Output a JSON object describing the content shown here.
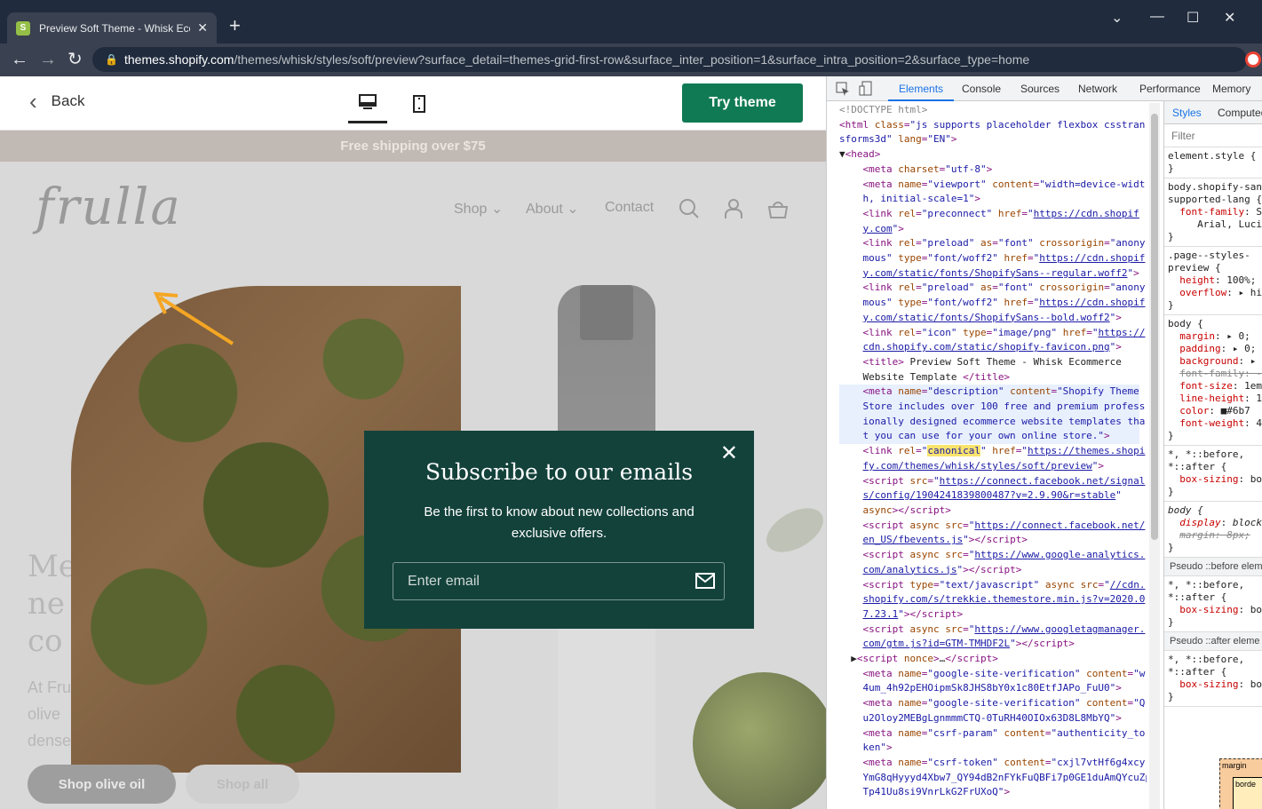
{
  "browser": {
    "tab_title": "Preview Soft Theme - Whisk Ecor",
    "url_host": "themes.shopify.com",
    "url_path": "/themes/whisk/styles/soft/preview?surface_detail=themes-grid-first-row&surface_inter_position=1&surface_intra_position=2&surface_type=home"
  },
  "preview_bar": {
    "back_label": "Back",
    "try_label": "Try theme"
  },
  "store": {
    "promo": "Free shipping over $75",
    "logo": "frulla",
    "nav": [
      "Shop",
      "About",
      "Contact"
    ],
    "hero_title_lines": [
      "Me",
      "ne",
      "co"
    ],
    "hero_sub_lines": [
      "At Fru",
      "olive",
      "dense"
    ],
    "btn_primary": "Shop olive oil",
    "btn_secondary": "Shop all"
  },
  "modal": {
    "title": "Subscribe to our emails",
    "body": "Be the first to know about new collections and exclusive offers.",
    "placeholder": "Enter email"
  },
  "devtools": {
    "tabs": [
      "Elements",
      "Console",
      "Sources",
      "Network",
      "Performance",
      "Memory"
    ],
    "style_tabs": [
      "Styles",
      "Computed"
    ],
    "filter": "Filter",
    "pseudo_before": "Pseudo ::before elem",
    "pseudo_after": "Pseudo ::after eleme",
    "box_margin": "margin",
    "box_border": "borde"
  },
  "colors": {
    "try_button": "#107a54",
    "modal_bg": "#13423b",
    "arrow": "#f5a623"
  }
}
